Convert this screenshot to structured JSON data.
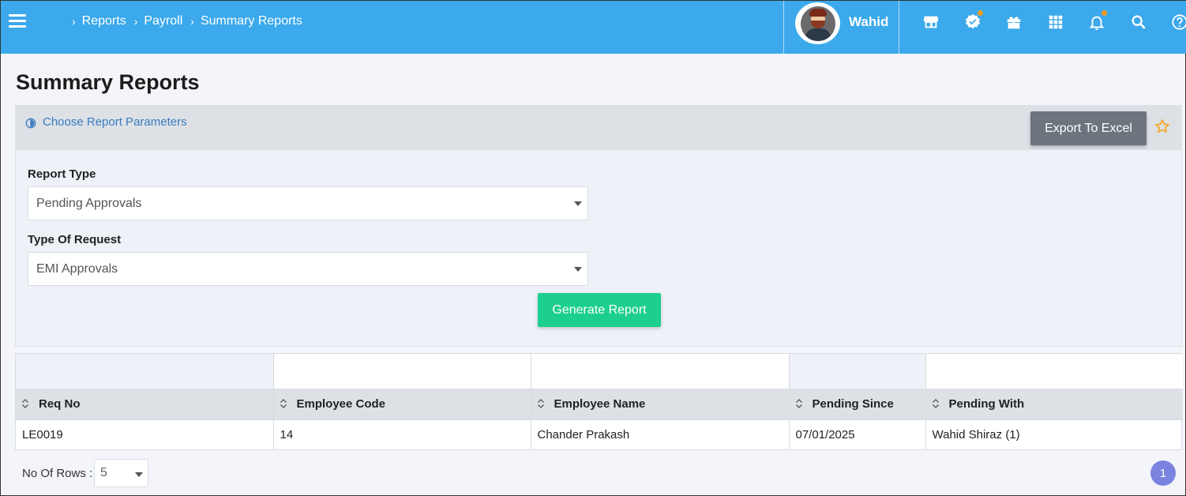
{
  "header": {
    "breadcrumbs": [
      {
        "label": "Reports"
      },
      {
        "label": "Payroll"
      },
      {
        "label": "Summary Reports"
      }
    ],
    "separator": "›",
    "username": "Wahid"
  },
  "page": {
    "title": "Summary Reports"
  },
  "params": {
    "choose_label": "Choose Report Parameters",
    "export_label": "Export To Excel",
    "report_type_label": "Report Type",
    "report_type_value": "Pending Approvals",
    "request_type_label": "Type Of Request",
    "request_type_value": "EMI Approvals",
    "generate_label": "Generate Report"
  },
  "table": {
    "columns": [
      "Req No",
      "Employee Code",
      "Employee Name",
      "Pending Since",
      "Pending With"
    ],
    "rows": [
      [
        "LE0019",
        "14",
        "Chander Prakash",
        "07/01/2025",
        "Wahid Shiraz (1)"
      ]
    ]
  },
  "footer": {
    "rows_label": "No Of Rows :",
    "rows_value": "5",
    "page_number": "1"
  },
  "colors": {
    "topbar": "#3ba9eb",
    "generate": "#1dcf8f",
    "export": "#6c757d",
    "pagination": "#7b83e0",
    "notification_dot": "#f59a1b"
  }
}
